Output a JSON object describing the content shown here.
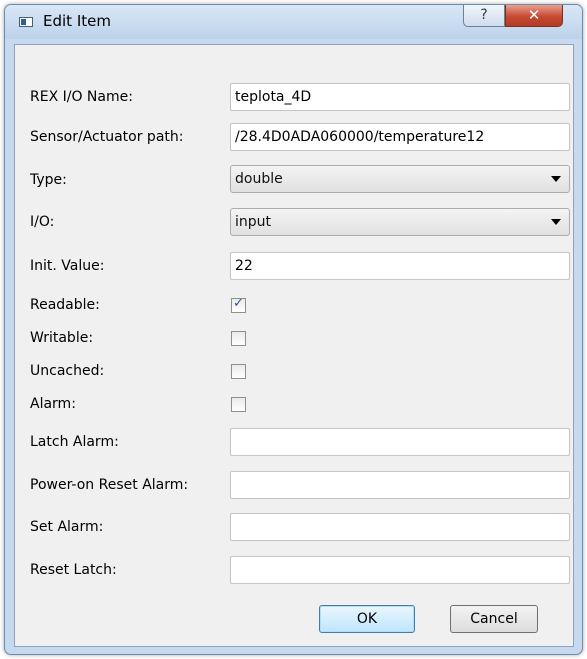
{
  "window": {
    "title": "Edit Item",
    "help_glyph": "?",
    "close_glyph": "✕"
  },
  "fields": {
    "rex_io_name": {
      "label": "REX I/O Name:",
      "value": "teplota_4D"
    },
    "sensor_path": {
      "label": "Sensor/Actuator path:",
      "value": "/28.4D0ADA060000/temperature12"
    },
    "type": {
      "label": "Type:",
      "selected": "double"
    },
    "io": {
      "label": "I/O:",
      "selected": "input"
    },
    "init_value": {
      "label": "Init. Value:",
      "value": "22"
    },
    "readable": {
      "label": "Readable:",
      "checked": true
    },
    "writable": {
      "label": "Writable:",
      "checked": false
    },
    "uncached": {
      "label": "Uncached:",
      "checked": false
    },
    "alarm": {
      "label": "Alarm:",
      "checked": false
    },
    "latch_alarm": {
      "label": "Latch Alarm:",
      "value": ""
    },
    "power_on_reset_alarm": {
      "label": "Power-on Reset Alarm:",
      "value": ""
    },
    "set_alarm": {
      "label": "Set Alarm:",
      "value": ""
    },
    "reset_latch": {
      "label": "Reset Latch:",
      "value": ""
    }
  },
  "buttons": {
    "ok": "OK",
    "cancel": "Cancel"
  },
  "icons": {
    "app": "window-app-icon",
    "help": "help-icon",
    "close": "close-icon",
    "dropdown": "chevron-down-icon",
    "check": "checkmark-icon"
  }
}
